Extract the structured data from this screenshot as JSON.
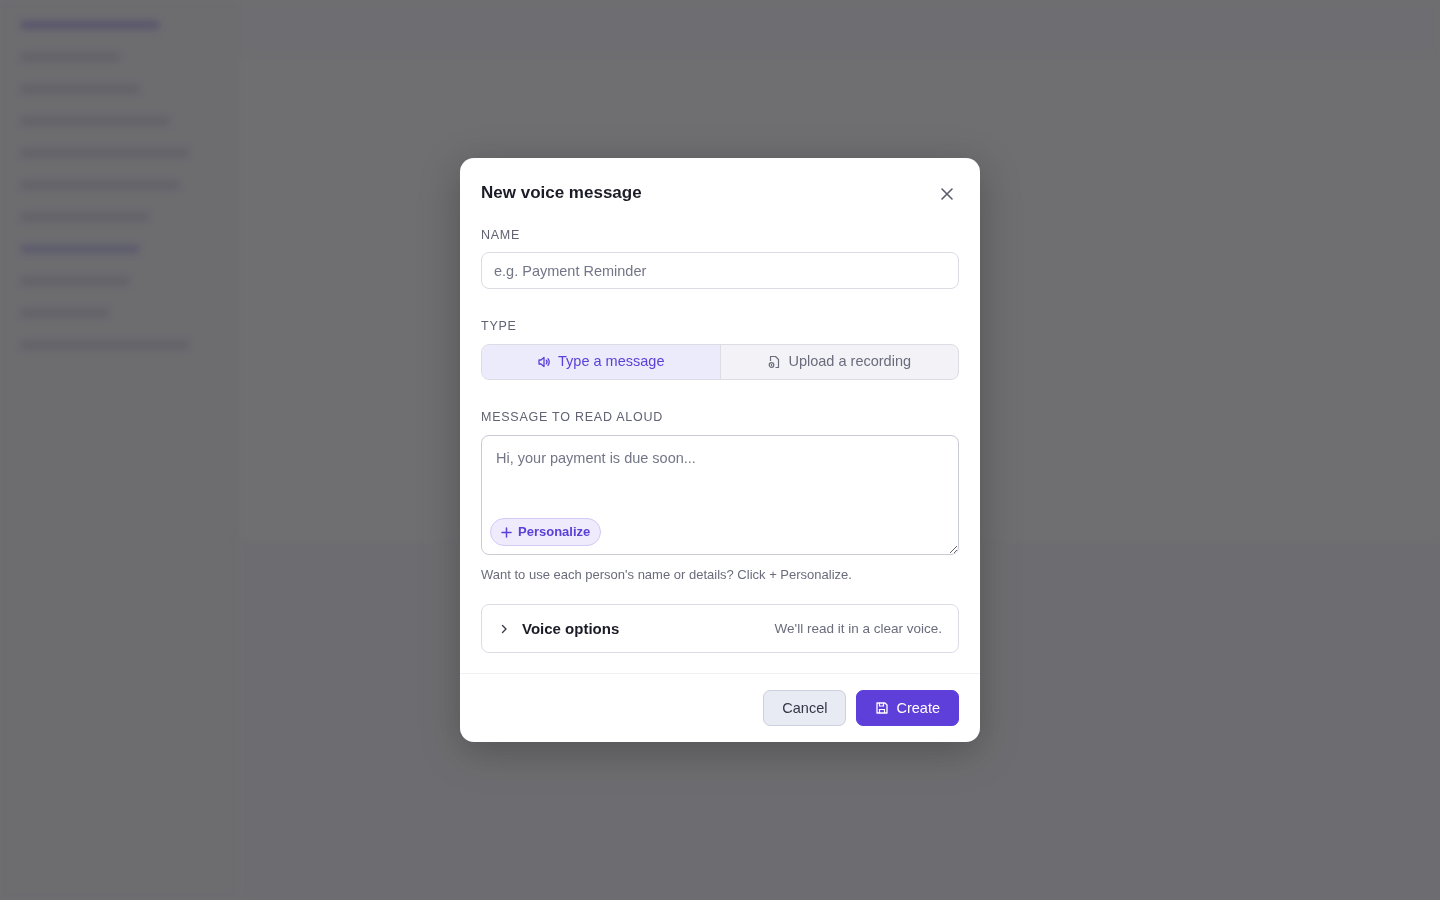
{
  "dialog": {
    "title": "New voice message",
    "name_field": {
      "label": "NAME",
      "placeholder": "e.g. Payment Reminder"
    },
    "type_field": {
      "label": "TYPE",
      "options": [
        {
          "label": "Type a message",
          "selected": true
        },
        {
          "label": "Upload a recording",
          "selected": false
        }
      ]
    },
    "message_field": {
      "label": "MESSAGE TO READ ALOUD",
      "placeholder": "Hi, your payment is due soon...",
      "personalize_button": "Personalize",
      "hint": "Want to use each person's name or details? Click + Personalize."
    },
    "voice_options": {
      "title": "Voice options",
      "summary": "We'll read it in a clear voice.",
      "expanded": false
    },
    "buttons": [
      {
        "label": "Cancel",
        "kind": "secondary"
      },
      {
        "label": "Create",
        "kind": "primary"
      }
    ]
  }
}
